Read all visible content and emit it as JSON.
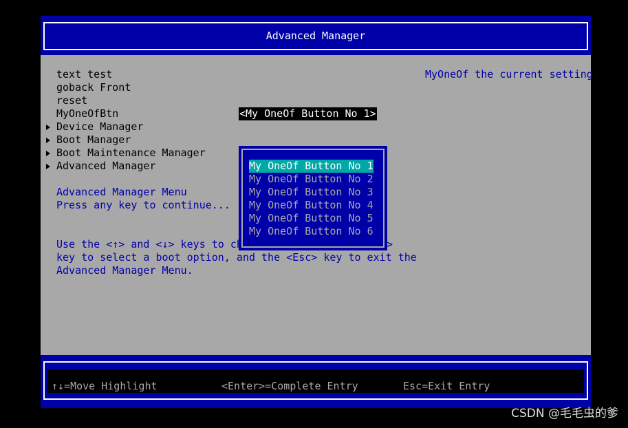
{
  "title": "Advanced Manager",
  "menu": {
    "items": [
      {
        "label": "text test",
        "submenu": false
      },
      {
        "label": "goback Front",
        "submenu": false
      },
      {
        "label": "reset",
        "submenu": false
      },
      {
        "label": "MyOneOfBtn",
        "submenu": false
      },
      {
        "label": "Device Manager",
        "submenu": true
      },
      {
        "label": "Boot Manager",
        "submenu": true
      },
      {
        "label": "Boot Maintenance Manager",
        "submenu": true
      },
      {
        "label": "Advanced Manager",
        "submenu": true
      }
    ],
    "current_value": "<My OneOf Button No 1>"
  },
  "help_text": "MyOneOf the current setting.",
  "info": {
    "menu_title": "Advanced Manager Menu",
    "prompt": "Press any key to continue...",
    "instructions": [
      "Use the <↑> and <↓> keys to choos",
      ">",
      "key to select a boot option, and the <Esc> key to exit the",
      "Advanced Manager Menu."
    ]
  },
  "popup": {
    "options": [
      "My OneOf Button No 1",
      "My OneOf Button No 2",
      "My OneOf Button No 3",
      "My OneOf Button No 4",
      "My OneOf Button No 5",
      "My OneOf Button No 6"
    ],
    "selected_index": 0
  },
  "footer": {
    "move": "↑↓=Move Highlight",
    "enter": "<Enter>=Complete Entry",
    "esc": "Esc=Exit Entry"
  },
  "watermark": "CSDN @毛毛虫的爹",
  "colors": {
    "bios_gray": "#a8a8a8",
    "bios_blue": "#0000a8",
    "highlight_cyan": "#00a8a8",
    "black": "#000000",
    "white": "#ffffff"
  }
}
